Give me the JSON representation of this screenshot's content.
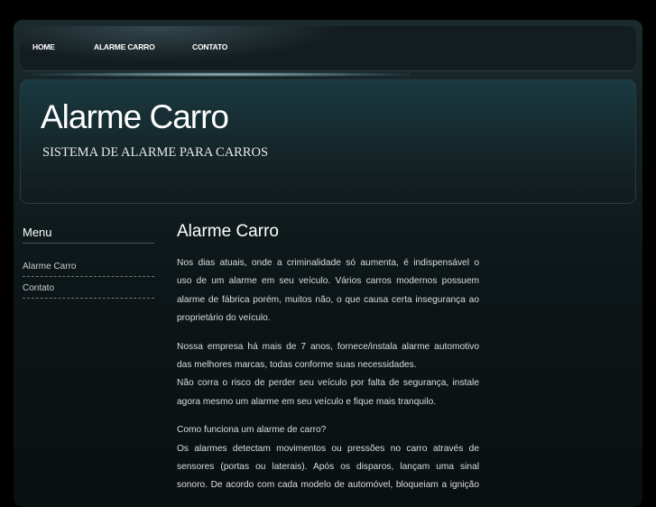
{
  "nav": {
    "items": [
      "HOME",
      "ALARME CARRO",
      "CONTATO"
    ]
  },
  "header": {
    "title": "Alarme Carro",
    "subtitle": "SISTEMA DE ALARME PARA CARROS"
  },
  "sidebar": {
    "heading": "Menu",
    "items": [
      "Alarme Carro",
      "Contato"
    ]
  },
  "main": {
    "title": "Alarme Carro",
    "paragraphs": [
      [
        "Nos dias atuais, onde a criminalidade só aumenta, é indispensável o",
        "uso de um alarme em seu veículo. Vários carros modernos possuem",
        "alarme de fábrica porém, muitos não, o que causa certa insegurança ao",
        "proprietário do veículo."
      ],
      [
        "Nossa empresa há mais de 7 anos, fornece/instala alarme automotivo",
        "das melhores marcas, todas conforme suas necessidades.",
        "Não corra o risco de perder seu veículo por falta de segurança, instale",
        "agora mesmo um alarme em seu veículo e fique mais tranquilo."
      ],
      [
        "Como funciona um alarme de carro?",
        "Os alarmes  detectam movimentos ou pressões no carro através de",
        "sensores (portas ou laterais). Após os disparos, lançam uma sinal",
        "sonoro. De acordo com cada modelo de automóvel, bloqueiam a ignição"
      ]
    ]
  }
}
